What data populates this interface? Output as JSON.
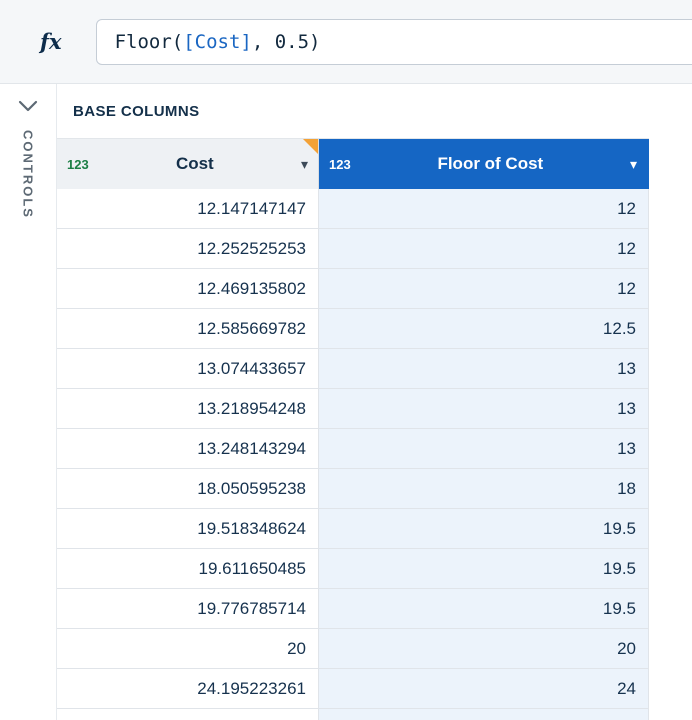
{
  "formula_bar": {
    "fx_label": "fx",
    "formula_prefix": "Floor(",
    "formula_ref": "[Cost]",
    "formula_suffix": ", 0.5)"
  },
  "sidebar": {
    "panel_label": "CONTROLS",
    "collapse_icon": "chevron-down"
  },
  "main": {
    "section_title": "BASE COLUMNS",
    "table": {
      "columns": [
        {
          "type_icon": "123",
          "label": "Cost",
          "selected": false
        },
        {
          "type_icon": "123",
          "label": "Floor of Cost",
          "selected": true
        }
      ],
      "rows": [
        {
          "cost": "12.147147147",
          "floor": "12"
        },
        {
          "cost": "12.252525253",
          "floor": "12"
        },
        {
          "cost": "12.469135802",
          "floor": "12"
        },
        {
          "cost": "12.585669782",
          "floor": "12.5"
        },
        {
          "cost": "13.074433657",
          "floor": "13"
        },
        {
          "cost": "13.218954248",
          "floor": "13"
        },
        {
          "cost": "13.248143294",
          "floor": "13"
        },
        {
          "cost": "18.050595238",
          "floor": "18"
        },
        {
          "cost": "19.518348624",
          "floor": "19.5"
        },
        {
          "cost": "19.611650485",
          "floor": "19.5"
        },
        {
          "cost": "19.776785714",
          "floor": "19.5"
        },
        {
          "cost": "20",
          "floor": "20"
        },
        {
          "cost": "24.195223261",
          "floor": "24"
        }
      ]
    }
  },
  "colors": {
    "selected_header_blue": "#1566c4",
    "selected_cell_blue": "#ecf3fb",
    "marker_orange": "#f3a237",
    "numeric_type_green": "#1c7f45"
  }
}
